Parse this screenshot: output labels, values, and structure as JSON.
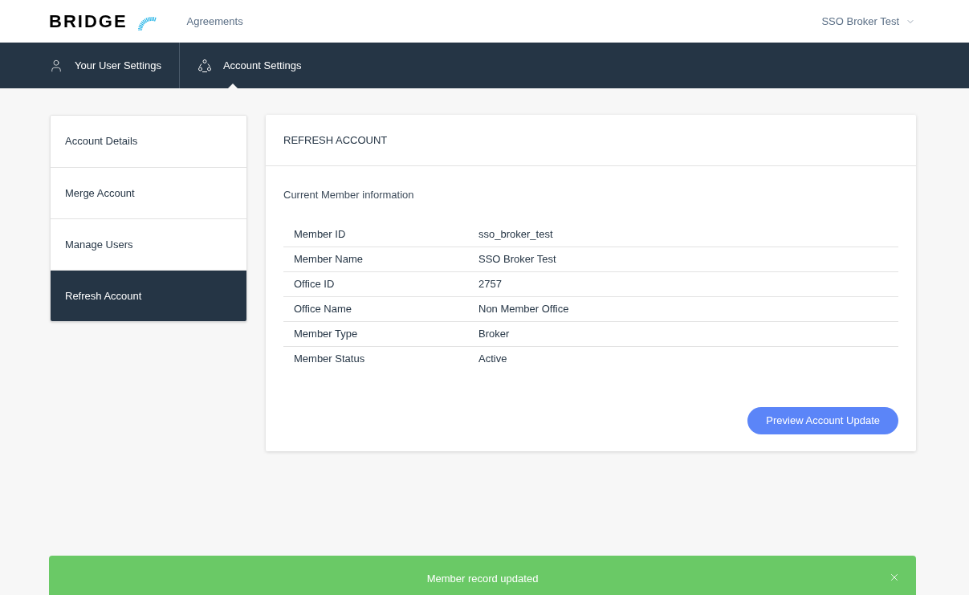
{
  "header": {
    "logo": "BRIDGE",
    "nav_link": "Agreements",
    "user_menu": "SSO Broker Test"
  },
  "tabs": [
    {
      "label": "Your User Settings",
      "kind": "user",
      "selected": false
    },
    {
      "label": "Account Settings",
      "kind": "group",
      "selected": true
    }
  ],
  "sidebar": {
    "items": [
      {
        "label": "Account Details",
        "selected": false
      },
      {
        "label": "Merge Account",
        "selected": false
      },
      {
        "label": "Manage Users",
        "selected": false
      },
      {
        "label": "Refresh Account",
        "selected": true
      }
    ]
  },
  "panel": {
    "title": "REFRESH ACCOUNT",
    "section_title": "Current Member information",
    "rows": [
      {
        "label": "Member ID",
        "value": "sso_broker_test"
      },
      {
        "label": "Member Name",
        "value": "SSO Broker Test"
      },
      {
        "label": "Office ID",
        "value": "2757"
      },
      {
        "label": "Office Name",
        "value": "Non Member Office"
      },
      {
        "label": "Member Type",
        "value": "Broker"
      },
      {
        "label": "Member Status",
        "value": "Active"
      }
    ],
    "button": "Preview Account Update"
  },
  "toast": {
    "message": "Member record updated"
  }
}
